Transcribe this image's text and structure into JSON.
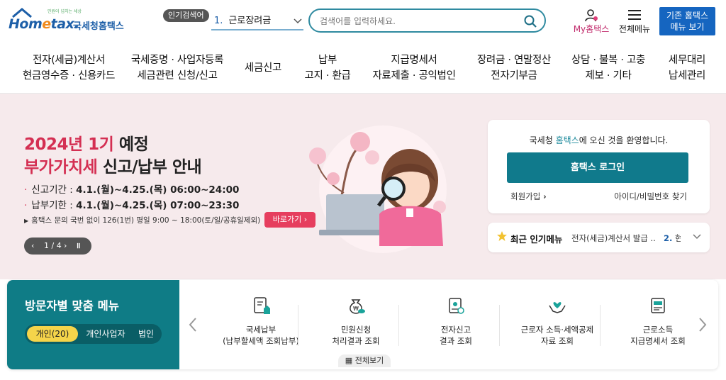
{
  "header": {
    "logo_small_text": "민원이 넘치는 세상",
    "logo_text_pre": "Hom",
    "logo_text_e": "e",
    "logo_text_post": "tax.",
    "logo_sub": "국세청홈택스",
    "popular_badge": "인기검색어",
    "popular_select": {
      "number": "1.",
      "value": "근로장려금"
    },
    "search_placeholder": "검색어를 입력하세요.",
    "my_hometax": "My홈택스",
    "all_menu": "전체메뉴",
    "legacy_button": [
      "기존 홈택스",
      "메뉴 보기"
    ]
  },
  "nav": [
    {
      "line1": "전자(세금)계산서",
      "line2": "현금영수증 · 신용카드"
    },
    {
      "line1": "국세증명 · 사업자등록",
      "line2": "세금관련 신청/신고"
    },
    {
      "line1": "세금신고",
      "line2": ""
    },
    {
      "line1": "납부",
      "line2": "고지 · 환급"
    },
    {
      "line1": "지급명세서",
      "line2": "자료제출 · 공익법인"
    },
    {
      "line1": "장려금 · 연말정산",
      "line2": "전자기부금"
    },
    {
      "line1": "상담 · 불복 · 고충",
      "line2": "제보 · 기타"
    },
    {
      "line1": "세무대리",
      "line2": "납세관리"
    }
  ],
  "hero": {
    "title1_red": "2024년 1기",
    "title1_dark": " 예정",
    "title2_red": "부가가치세",
    "title2_dark": " 신고/납부 안내",
    "line1_label": "신고기간 : ",
    "line1_value": "4.1.(월)~4.25.(목) 06:00~24:00",
    "line2_label": "납부기한 : ",
    "line2_value": "4.1.(월)~4.25.(목) 07:00~23:30",
    "note": "홈택스 문의 국번 없이 126(1번) 평일 9:00 ~ 18:00(토/일/공휴일제외)",
    "go_button": "바로가기",
    "pager": "1 / 4",
    "colors": {
      "accent": "#d42f52",
      "background": "#f6eaec"
    }
  },
  "login": {
    "welcome_pre": "국세청 ",
    "welcome_hl": "홈택스",
    "welcome_post": "에 오신 것을 환영합니다.",
    "login_button": "홈택스 로그인",
    "join": "회원가입",
    "find": "아이디/비밀번호 찾기"
  },
  "popular_menu": {
    "title": "최근 인기메뉴",
    "item1": "전자(세금)계산서 발급 ...",
    "item2_num": "2.",
    "item2_text": "현"
  },
  "visitor": {
    "title": "방문자별 맞춤 메뉴",
    "tabs": [
      "개인(20)",
      "개인사업자",
      "법인"
    ],
    "services": [
      {
        "line1": "국세납부",
        "line2": "(납부할세액 조회납부)",
        "icon": "tax-payment-icon"
      },
      {
        "line1": "민원신청",
        "line2": "처리결과 조회",
        "icon": "money-bag-icon"
      },
      {
        "line1": "전자신고",
        "line2": "결과 조회",
        "icon": "e-filing-icon"
      },
      {
        "line1": "근로자 소득·세액공제",
        "line2": "자료 조회",
        "icon": "hands-heart-icon"
      },
      {
        "line1": "근로소득",
        "line2": "지급명세서 조회",
        "icon": "statement-icon"
      }
    ],
    "view_all": "전체보기",
    "colors": {
      "panel": "#0f7c86",
      "active_tab": "#f5d44a"
    }
  }
}
